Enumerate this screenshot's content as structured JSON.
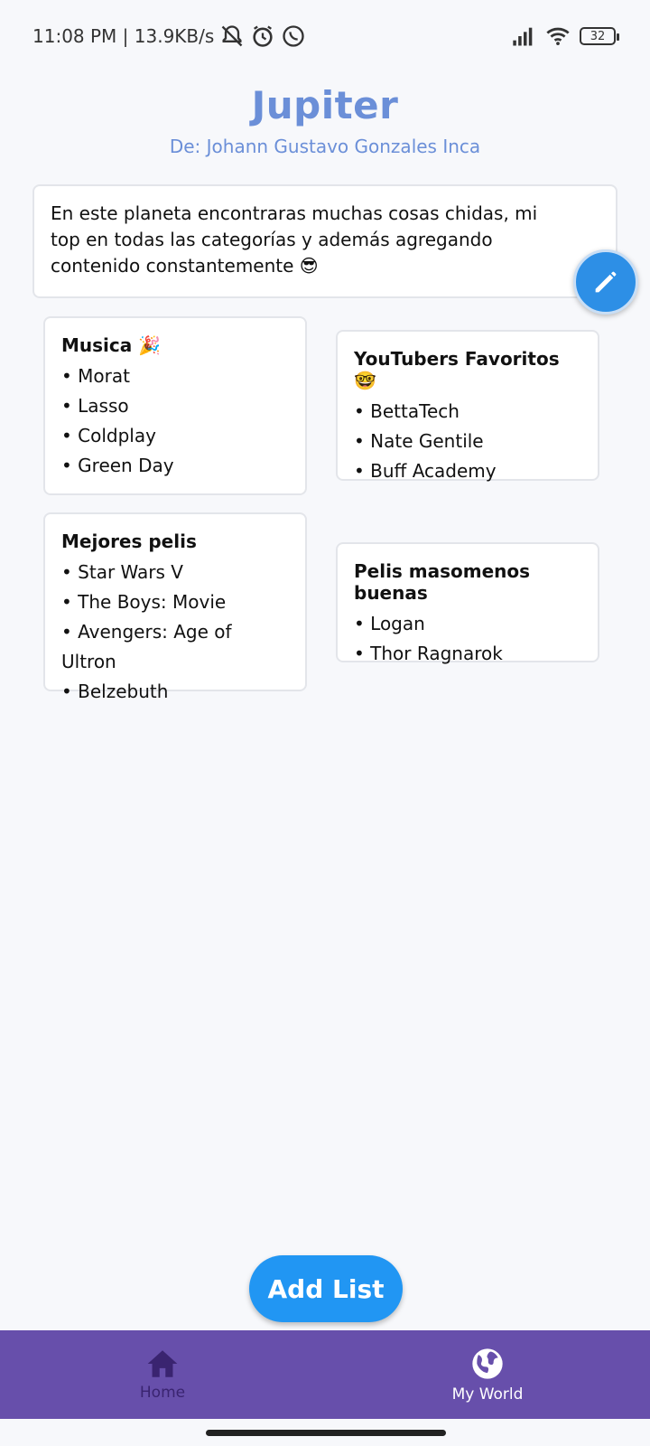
{
  "status_bar": {
    "time_speed": "11:08 PM | 13.9KB/s",
    "battery": "32"
  },
  "header": {
    "title": "Jupiter",
    "subtitle": "De: Johann Gustavo Gonzales Inca"
  },
  "description": {
    "text": "En este planeta encontraras muchas cosas chidas, mi top en todas las categorías y además agregando contenido constantemente 😎"
  },
  "lists": [
    {
      "title": "Musica 🎉",
      "items": [
        "Morat",
        "Lasso",
        "Coldplay",
        "Green Day"
      ]
    },
    {
      "title": "YouTubers Favoritos 🤓",
      "items": [
        "BettaTech",
        "Nate Gentile",
        "Buff Academy"
      ]
    },
    {
      "title": "Mejores pelis",
      "items": [
        "Star Wars V",
        "The Boys: Movie",
        "Avengers: Age of Ultron",
        "Belzebuth"
      ]
    },
    {
      "title": "Pelis masomenos buenas",
      "items": [
        "Logan",
        "Thor Ragnarok"
      ]
    }
  ],
  "actions": {
    "add_list_label": "Add List"
  },
  "bottom_nav": {
    "items": [
      {
        "label": "Home",
        "icon": "home-icon"
      },
      {
        "label": "My World",
        "icon": "globe-icon"
      }
    ]
  },
  "colors": {
    "accent": "#6b8fd8",
    "fab": "#2d8fe6",
    "button": "#2196f3",
    "nav_bg": "#674fab"
  }
}
